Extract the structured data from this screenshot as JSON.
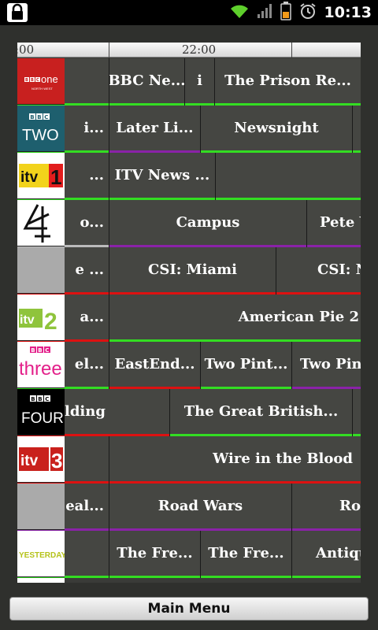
{
  "status_bar": {
    "time": "10:13",
    "icons": [
      "lock-icon",
      "wifi-icon",
      "signal-icon",
      "battery-icon",
      "alarm-icon"
    ]
  },
  "timebar": {
    "labels": [
      ":00",
      "22:00"
    ]
  },
  "colors": {
    "green": "#33dd22",
    "purple": "#8a22a8",
    "red": "#dd1111",
    "grey": "#bbbbbb"
  },
  "channels": [
    {
      "name": "BBC one",
      "sub": "NORTH WEST",
      "logo": "bbc-one-logo",
      "programmes": [
        "",
        "BBC Ne...",
        "i",
        "The Prison Re..."
      ]
    },
    {
      "name": "BBC TWO",
      "logo": "bbc-two-logo",
      "programmes": [
        "i...",
        "Later Li...",
        "Newsnight",
        ""
      ]
    },
    {
      "name": "itv 1",
      "logo": "itv1-logo",
      "programmes": [
        "...",
        "ITV News ...",
        ""
      ]
    },
    {
      "name": "4",
      "logo": "channel4-logo",
      "programmes": [
        "o...",
        "Campus",
        "Pete V"
      ]
    },
    {
      "name": "",
      "logo": "blank-logo",
      "programmes": [
        "e ...",
        "CSI: Miami",
        "CSI: N"
      ]
    },
    {
      "name": "itv 2",
      "logo": "itv2-logo",
      "programmes": [
        "a...",
        "American Pie 2"
      ]
    },
    {
      "name": "BBC three",
      "logo": "bbc-three-logo",
      "programmes": [
        "el...",
        "EastEnd...",
        "Two Pint...",
        "Two Pint"
      ]
    },
    {
      "name": "BBC FOUR",
      "logo": "bbc-four-logo",
      "programmes": [
        "lding",
        "The Great British...",
        ""
      ]
    },
    {
      "name": "itv 3",
      "logo": "itv3-logo",
      "programmes": [
        "",
        "Wire in the Blood"
      ]
    },
    {
      "name": "",
      "logo": "blank-logo",
      "programmes": [
        "eal...",
        "Road Wars",
        "Ro"
      ]
    },
    {
      "name": "YESTERDAY",
      "logo": "yesterday-logo",
      "programmes": [
        "",
        "The Fre...",
        "The Fre...",
        "Antiqu"
      ]
    }
  ],
  "footer": {
    "menu_label": "Main Menu"
  }
}
